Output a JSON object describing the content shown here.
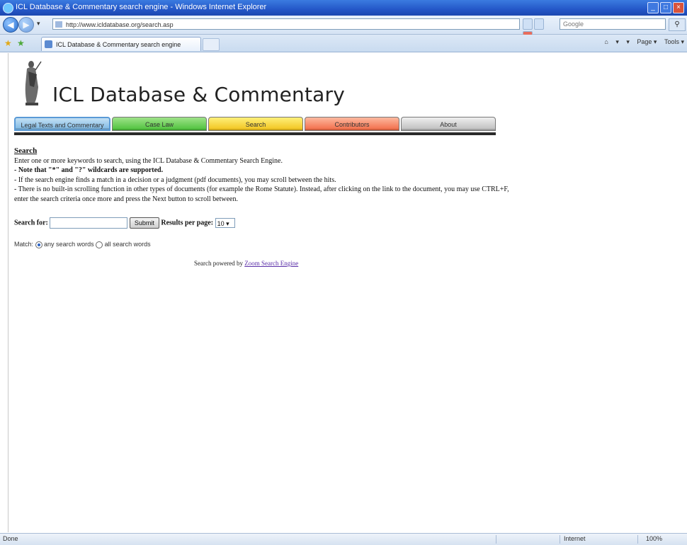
{
  "window": {
    "title": "ICL Database & Commentary search engine - Windows Internet Explorer"
  },
  "address": {
    "url": "http://www.icldatabase.org/search.asp"
  },
  "search_box": {
    "placeholder": "Google"
  },
  "ie_tab": {
    "label": "ICL Database & Commentary search engine"
  },
  "command_bar": {
    "home": "⌂",
    "feeds": "▾",
    "print": "▾",
    "page": "Page ▾",
    "tools": "Tools ▾"
  },
  "site": {
    "title": "ICL Database & Commentary",
    "tabs": [
      "Legal Texts and Commentary",
      "Case Law",
      "Search",
      "Contributors",
      "About"
    ]
  },
  "search": {
    "heading": "Search",
    "intro": "Enter one or more keywords to search, using the ICL Database & Commentary Search Engine.",
    "wildcards": "- Note that \"*\" and \"?\" wildcards are supported.",
    "tip1": "- If the search engine finds a match in a decision or a judgment (pdf documents), you may scroll between the hits.",
    "tip2": "- There is no built-in scrolling function in other types of documents (for example the Rome Statute). Instead, after clicking on the link to the document, you may use CTRL+F, enter the search criteria once more and press the Next button to scroll between.",
    "search_for_label": "Search for:",
    "submit_label": "Submit",
    "results_per_page_label": "Results per page:",
    "results_per_page_value": "10",
    "match_label": "Match:",
    "match_any": "any search words",
    "match_all": "all search words",
    "powered_by_text": "Search powered by",
    "powered_by_link": "Zoom Search Engine"
  },
  "statusbar": {
    "left": "Done",
    "zone": "Internet",
    "zoom": "100%"
  }
}
